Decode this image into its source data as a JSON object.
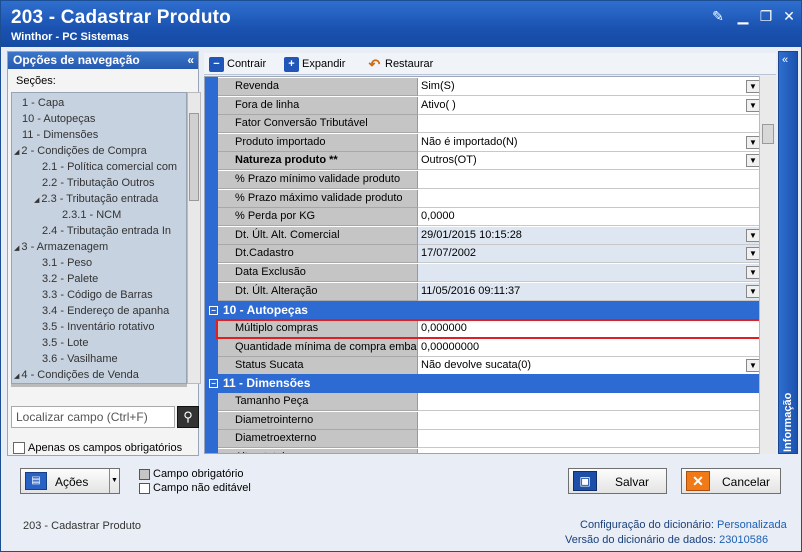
{
  "window": {
    "title": "203 - Cadastrar  Produto",
    "subtitle": "Winthor - PC Sistemas"
  },
  "nav": {
    "header": "Opções de navegação",
    "sections_label": "Seções:",
    "tree": [
      {
        "label": "1 - Capa",
        "level": 0,
        "expander": ""
      },
      {
        "label": "10 - Autopeças",
        "level": 0,
        "expander": ""
      },
      {
        "label": "11 - Dimensões",
        "level": 0,
        "expander": ""
      },
      {
        "label": "2 - Condições de Compra",
        "level": 0,
        "expander": "◢"
      },
      {
        "label": "2.1 - Política comercial com",
        "level": 1,
        "expander": ""
      },
      {
        "label": "2.2 - Tributação Outros",
        "level": 1,
        "expander": ""
      },
      {
        "label": "2.3 - Tributação entrada",
        "level": 1,
        "expander": "◢"
      },
      {
        "label": "2.3.1 - NCM",
        "level": 2,
        "expander": ""
      },
      {
        "label": "2.4 - Tributação entrada In",
        "level": 1,
        "expander": ""
      },
      {
        "label": "3 - Armazenagem",
        "level": 0,
        "expander": "◢"
      },
      {
        "label": "3.1 - Peso",
        "level": 1,
        "expander": ""
      },
      {
        "label": "3.2 - Palete",
        "level": 1,
        "expander": ""
      },
      {
        "label": "3.3 - Código de Barras",
        "level": 1,
        "expander": ""
      },
      {
        "label": "3.4 - Endereço de apanha",
        "level": 1,
        "expander": ""
      },
      {
        "label": "3.5 - Inventário rotativo",
        "level": 1,
        "expander": ""
      },
      {
        "label": "3.5 - Lote",
        "level": 1,
        "expander": ""
      },
      {
        "label": "3.6 - Vasilhame",
        "level": 1,
        "expander": ""
      },
      {
        "label": "4 - Condições de Venda",
        "level": 0,
        "expander": "◢"
      }
    ],
    "search_placeholder": "Localizar campo (Ctrl+F)",
    "required_only_label": "Apenas os campos obrigatórios"
  },
  "toolbar": {
    "collapse_label": "Contrair",
    "expand_label": "Expandir",
    "restore_label": "Restaurar"
  },
  "grid": {
    "rows_top": [
      {
        "label": "Revenda",
        "value": "Sim(S)",
        "dropdown": true,
        "bold": false
      },
      {
        "label": "Fora de linha",
        "value": "Ativo(  )",
        "dropdown": true,
        "bold": false
      },
      {
        "label": "Fator Conversão Tributável",
        "value": "",
        "dropdown": false,
        "bold": false
      },
      {
        "label": "Produto importado",
        "value": "Não é importado(N)",
        "dropdown": true,
        "bold": false
      },
      {
        "label": "Natureza produto **",
        "value": "Outros(OT)",
        "dropdown": true,
        "bold": true
      },
      {
        "label": "% Prazo mínimo validade produto",
        "value": "",
        "dropdown": false,
        "bold": false
      },
      {
        "label": "% Prazo máximo validade produto",
        "value": "",
        "dropdown": false,
        "bold": false
      },
      {
        "label": "% Perda por KG",
        "value": "0,0000",
        "dropdown": false,
        "bold": false
      },
      {
        "label": "Dt. Últ. Alt. Comercial",
        "value": "29/01/2015 10:15:28",
        "dropdown": true,
        "bold": false,
        "alt": true
      },
      {
        "label": "Dt.Cadastro",
        "value": "17/07/2002",
        "dropdown": true,
        "bold": false,
        "alt": true
      },
      {
        "label": "Data Exclusão",
        "value": "",
        "dropdown": true,
        "bold": false,
        "alt": true
      },
      {
        "label": "Dt. Últ. Alteração",
        "value": "11/05/2016 09:11:37",
        "dropdown": true,
        "bold": false,
        "alt": true
      }
    ],
    "section_autopecas": "10 - Autopeças",
    "rows_autopecas": [
      {
        "label": "Múltiplo compras",
        "value": "0,000000",
        "dropdown": false,
        "bold": false
      },
      {
        "label": "Quantidade mínima de compra embala",
        "value": "0,00000000",
        "dropdown": false,
        "bold": false
      },
      {
        "label": "Status Sucata",
        "value": "Não devolve sucata(0)",
        "dropdown": true,
        "bold": false
      }
    ],
    "section_dimensoes": "11 - Dimensões",
    "rows_dimensoes": [
      {
        "label": "Tamanho Peça",
        "value": "",
        "dropdown": false,
        "bold": false
      },
      {
        "label": "Diametrointerno",
        "value": "",
        "dropdown": false,
        "bold": false
      },
      {
        "label": "Diametroexterno",
        "value": "",
        "dropdown": false,
        "bold": false
      },
      {
        "label": "Alturatotal",
        "value": "",
        "dropdown": false,
        "bold": false
      }
    ]
  },
  "info_tab": "Informação",
  "footer": {
    "actions_label": "Ações",
    "legend_required": "Campo obrigatório",
    "legend_readonly": "Campo não editável",
    "save_label": "Salvar",
    "cancel_label": "Cancelar",
    "status_left": "203 - Cadastrar  Produto",
    "dict_config_label": "Configuração do dicionário:",
    "dict_config_value": "Personalizada",
    "dict_version_label": "Versão do dicionário de dados:",
    "dict_version_value": "23010586"
  },
  "colors": {
    "title_blue": "#1a52b0",
    "section_blue": "#2d6ad2",
    "highlight_red": "#e02020",
    "label_gray": "#c5c5c5"
  }
}
